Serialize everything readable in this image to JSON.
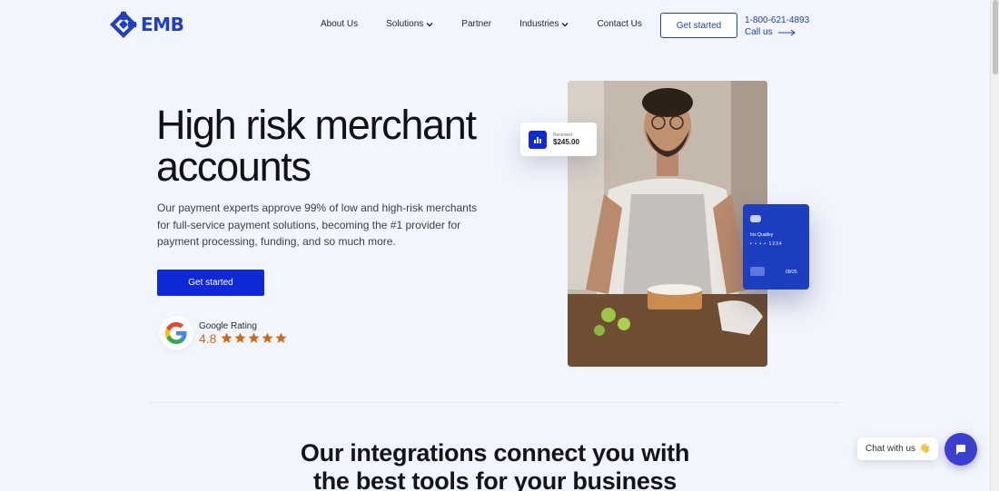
{
  "header": {
    "logo_text": "EMB",
    "nav": [
      {
        "label": "About Us",
        "has_dropdown": false
      },
      {
        "label": "Solutions",
        "has_dropdown": true
      },
      {
        "label": "Partner",
        "has_dropdown": false
      },
      {
        "label": "Industries",
        "has_dropdown": true
      },
      {
        "label": "Contact Us",
        "has_dropdown": false
      }
    ],
    "cta_label": "Get started",
    "phone": "1-800-621-4893",
    "call_label": "Call us"
  },
  "hero": {
    "title_line1": "High risk merchant",
    "title_line2": "accounts",
    "description": "Our payment experts approve 99% of low and high-risk merchants for full-service payment solutions, becoming the #1 provider for payment processing, funding, and so much more.",
    "cta_label": "Get started",
    "rating": {
      "label": "Google Rating",
      "value": "4.8",
      "stars": 5
    }
  },
  "received_card": {
    "label": "Received",
    "amount": "$245.00"
  },
  "credit_card": {
    "name": "Iris Quatley",
    "number": "• • • •  1234",
    "expiry": "09/25"
  },
  "integrations": {
    "title_line1": "Our integrations connect you with",
    "title_line2": "the best tools for your business"
  },
  "chat": {
    "label": "Chat with us",
    "emoji": "👋"
  },
  "colors": {
    "brand": "#1f3fc7",
    "primary_button": "#1029d8",
    "rating": "#d06a18",
    "chat_button": "#3a3fcf",
    "background": "#f3f5fd"
  }
}
